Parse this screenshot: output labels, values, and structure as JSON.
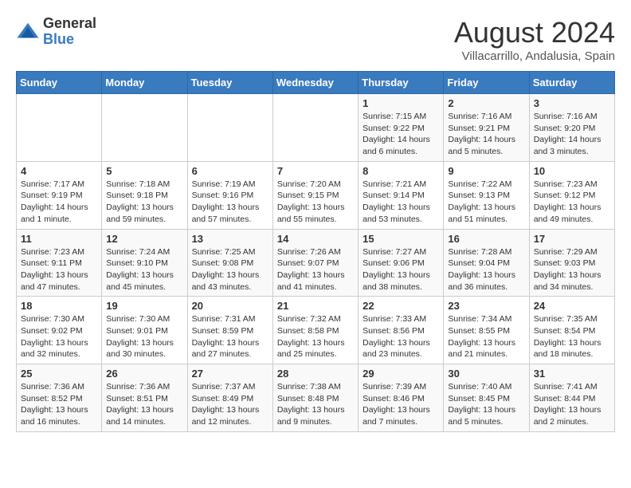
{
  "header": {
    "logo_general": "General",
    "logo_blue": "Blue",
    "month_title": "August 2024",
    "subtitle": "Villacarrillo, Andalusia, Spain"
  },
  "weekdays": [
    "Sunday",
    "Monday",
    "Tuesday",
    "Wednesday",
    "Thursday",
    "Friday",
    "Saturday"
  ],
  "weeks": [
    [
      {
        "day": "",
        "info": ""
      },
      {
        "day": "",
        "info": ""
      },
      {
        "day": "",
        "info": ""
      },
      {
        "day": "",
        "info": ""
      },
      {
        "day": "1",
        "info": "Sunrise: 7:15 AM\nSunset: 9:22 PM\nDaylight: 14 hours\nand 6 minutes."
      },
      {
        "day": "2",
        "info": "Sunrise: 7:16 AM\nSunset: 9:21 PM\nDaylight: 14 hours\nand 5 minutes."
      },
      {
        "day": "3",
        "info": "Sunrise: 7:16 AM\nSunset: 9:20 PM\nDaylight: 14 hours\nand 3 minutes."
      }
    ],
    [
      {
        "day": "4",
        "info": "Sunrise: 7:17 AM\nSunset: 9:19 PM\nDaylight: 14 hours\nand 1 minute."
      },
      {
        "day": "5",
        "info": "Sunrise: 7:18 AM\nSunset: 9:18 PM\nDaylight: 13 hours\nand 59 minutes."
      },
      {
        "day": "6",
        "info": "Sunrise: 7:19 AM\nSunset: 9:16 PM\nDaylight: 13 hours\nand 57 minutes."
      },
      {
        "day": "7",
        "info": "Sunrise: 7:20 AM\nSunset: 9:15 PM\nDaylight: 13 hours\nand 55 minutes."
      },
      {
        "day": "8",
        "info": "Sunrise: 7:21 AM\nSunset: 9:14 PM\nDaylight: 13 hours\nand 53 minutes."
      },
      {
        "day": "9",
        "info": "Sunrise: 7:22 AM\nSunset: 9:13 PM\nDaylight: 13 hours\nand 51 minutes."
      },
      {
        "day": "10",
        "info": "Sunrise: 7:23 AM\nSunset: 9:12 PM\nDaylight: 13 hours\nand 49 minutes."
      }
    ],
    [
      {
        "day": "11",
        "info": "Sunrise: 7:23 AM\nSunset: 9:11 PM\nDaylight: 13 hours\nand 47 minutes."
      },
      {
        "day": "12",
        "info": "Sunrise: 7:24 AM\nSunset: 9:10 PM\nDaylight: 13 hours\nand 45 minutes."
      },
      {
        "day": "13",
        "info": "Sunrise: 7:25 AM\nSunset: 9:08 PM\nDaylight: 13 hours\nand 43 minutes."
      },
      {
        "day": "14",
        "info": "Sunrise: 7:26 AM\nSunset: 9:07 PM\nDaylight: 13 hours\nand 41 minutes."
      },
      {
        "day": "15",
        "info": "Sunrise: 7:27 AM\nSunset: 9:06 PM\nDaylight: 13 hours\nand 38 minutes."
      },
      {
        "day": "16",
        "info": "Sunrise: 7:28 AM\nSunset: 9:04 PM\nDaylight: 13 hours\nand 36 minutes."
      },
      {
        "day": "17",
        "info": "Sunrise: 7:29 AM\nSunset: 9:03 PM\nDaylight: 13 hours\nand 34 minutes."
      }
    ],
    [
      {
        "day": "18",
        "info": "Sunrise: 7:30 AM\nSunset: 9:02 PM\nDaylight: 13 hours\nand 32 minutes."
      },
      {
        "day": "19",
        "info": "Sunrise: 7:30 AM\nSunset: 9:01 PM\nDaylight: 13 hours\nand 30 minutes."
      },
      {
        "day": "20",
        "info": "Sunrise: 7:31 AM\nSunset: 8:59 PM\nDaylight: 13 hours\nand 27 minutes."
      },
      {
        "day": "21",
        "info": "Sunrise: 7:32 AM\nSunset: 8:58 PM\nDaylight: 13 hours\nand 25 minutes."
      },
      {
        "day": "22",
        "info": "Sunrise: 7:33 AM\nSunset: 8:56 PM\nDaylight: 13 hours\nand 23 minutes."
      },
      {
        "day": "23",
        "info": "Sunrise: 7:34 AM\nSunset: 8:55 PM\nDaylight: 13 hours\nand 21 minutes."
      },
      {
        "day": "24",
        "info": "Sunrise: 7:35 AM\nSunset: 8:54 PM\nDaylight: 13 hours\nand 18 minutes."
      }
    ],
    [
      {
        "day": "25",
        "info": "Sunrise: 7:36 AM\nSunset: 8:52 PM\nDaylight: 13 hours\nand 16 minutes."
      },
      {
        "day": "26",
        "info": "Sunrise: 7:36 AM\nSunset: 8:51 PM\nDaylight: 13 hours\nand 14 minutes."
      },
      {
        "day": "27",
        "info": "Sunrise: 7:37 AM\nSunset: 8:49 PM\nDaylight: 13 hours\nand 12 minutes."
      },
      {
        "day": "28",
        "info": "Sunrise: 7:38 AM\nSunset: 8:48 PM\nDaylight: 13 hours\nand 9 minutes."
      },
      {
        "day": "29",
        "info": "Sunrise: 7:39 AM\nSunset: 8:46 PM\nDaylight: 13 hours\nand 7 minutes."
      },
      {
        "day": "30",
        "info": "Sunrise: 7:40 AM\nSunset: 8:45 PM\nDaylight: 13 hours\nand 5 minutes."
      },
      {
        "day": "31",
        "info": "Sunrise: 7:41 AM\nSunset: 8:44 PM\nDaylight: 13 hours\nand 2 minutes."
      }
    ]
  ]
}
